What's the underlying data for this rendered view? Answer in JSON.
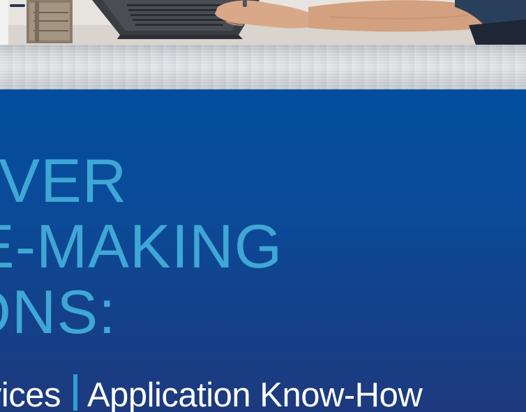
{
  "photo": {
    "alt_subject": "person typing on laptop"
  },
  "headline": {
    "line1": "LIVER",
    "line2": "E-MAKING",
    "line3": "IONS:"
  },
  "tagline": {
    "left": "rvices",
    "right": "Application Know-How"
  },
  "colors": {
    "panel_top": "#024e9c",
    "panel_bottom": "#1e3a7e",
    "headline": "#3fa7d6",
    "tagline": "#ffffff",
    "separator": "#2f9fd6"
  }
}
